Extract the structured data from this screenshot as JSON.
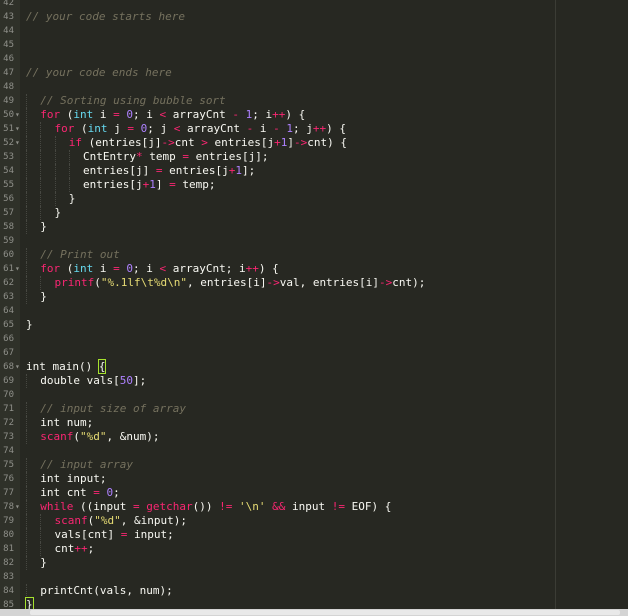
{
  "editor": {
    "colors": {
      "background": "#272822",
      "comment": "#75715e",
      "keyword": "#f92672",
      "type": "#66d9ef",
      "number": "#ae81ff",
      "string": "#e6db74",
      "function": "#a6e22e",
      "text": "#f8f8f2"
    },
    "lines": [
      {
        "n": "42",
        "fold": false,
        "indent": 0,
        "tokens": []
      },
      {
        "n": "43",
        "fold": false,
        "indent": 0,
        "tokens": [
          {
            "t": "// your code starts here",
            "c": "comment"
          }
        ]
      },
      {
        "n": "44",
        "fold": false,
        "indent": 0,
        "tokens": []
      },
      {
        "n": "45",
        "fold": false,
        "indent": 0,
        "tokens": []
      },
      {
        "n": "46",
        "fold": false,
        "indent": 0,
        "tokens": []
      },
      {
        "n": "47",
        "fold": false,
        "indent": 0,
        "tokens": [
          {
            "t": "// your code ends here",
            "c": "comment"
          }
        ]
      },
      {
        "n": "48",
        "fold": false,
        "indent": 0,
        "tokens": []
      },
      {
        "n": "49",
        "fold": false,
        "indent": 1,
        "tokens": [
          {
            "t": "// Sorting using bubble sort",
            "c": "comment"
          }
        ]
      },
      {
        "n": "50",
        "fold": true,
        "indent": 1,
        "tokens": [
          {
            "t": "for",
            "c": "keyword"
          },
          {
            "t": " (",
            "c": "text"
          },
          {
            "t": "int",
            "c": "type"
          },
          {
            "t": " i ",
            "c": "text"
          },
          {
            "t": "=",
            "c": "keyword"
          },
          {
            "t": " ",
            "c": "text"
          },
          {
            "t": "0",
            "c": "number"
          },
          {
            "t": "; i ",
            "c": "text"
          },
          {
            "t": "<",
            "c": "keyword"
          },
          {
            "t": " arrayCnt ",
            "c": "text"
          },
          {
            "t": "-",
            "c": "keyword"
          },
          {
            "t": " ",
            "c": "text"
          },
          {
            "t": "1",
            "c": "number"
          },
          {
            "t": "; i",
            "c": "text"
          },
          {
            "t": "++",
            "c": "keyword"
          },
          {
            "t": ") {",
            "c": "text"
          }
        ]
      },
      {
        "n": "51",
        "fold": true,
        "indent": 2,
        "tokens": [
          {
            "t": "for",
            "c": "keyword"
          },
          {
            "t": " (",
            "c": "text"
          },
          {
            "t": "int",
            "c": "type"
          },
          {
            "t": " j ",
            "c": "text"
          },
          {
            "t": "=",
            "c": "keyword"
          },
          {
            "t": " ",
            "c": "text"
          },
          {
            "t": "0",
            "c": "number"
          },
          {
            "t": "; j ",
            "c": "text"
          },
          {
            "t": "<",
            "c": "keyword"
          },
          {
            "t": " arrayCnt ",
            "c": "text"
          },
          {
            "t": "-",
            "c": "keyword"
          },
          {
            "t": " i ",
            "c": "text"
          },
          {
            "t": "-",
            "c": "keyword"
          },
          {
            "t": " ",
            "c": "text"
          },
          {
            "t": "1",
            "c": "number"
          },
          {
            "t": "; j",
            "c": "text"
          },
          {
            "t": "++",
            "c": "keyword"
          },
          {
            "t": ") {",
            "c": "text"
          }
        ]
      },
      {
        "n": "52",
        "fold": true,
        "indent": 3,
        "tokens": [
          {
            "t": "if",
            "c": "keyword"
          },
          {
            "t": " (entries[j]",
            "c": "text"
          },
          {
            "t": "->",
            "c": "keyword"
          },
          {
            "t": "cnt ",
            "c": "text"
          },
          {
            "t": ">",
            "c": "keyword"
          },
          {
            "t": " entries[j",
            "c": "text"
          },
          {
            "t": "+",
            "c": "keyword"
          },
          {
            "t": "1",
            "c": "number"
          },
          {
            "t": "]",
            "c": "text"
          },
          {
            "t": "->",
            "c": "keyword"
          },
          {
            "t": "cnt) {",
            "c": "text"
          }
        ]
      },
      {
        "n": "53",
        "fold": false,
        "indent": 4,
        "tokens": [
          {
            "t": "CntEntry",
            "c": "text"
          },
          {
            "t": "*",
            "c": "keyword"
          },
          {
            "t": " temp ",
            "c": "text"
          },
          {
            "t": "=",
            "c": "keyword"
          },
          {
            "t": " entries[j];",
            "c": "text"
          }
        ]
      },
      {
        "n": "54",
        "fold": false,
        "indent": 4,
        "tokens": [
          {
            "t": "entries[j] ",
            "c": "text"
          },
          {
            "t": "=",
            "c": "keyword"
          },
          {
            "t": " entries[j",
            "c": "text"
          },
          {
            "t": "+",
            "c": "keyword"
          },
          {
            "t": "1",
            "c": "number"
          },
          {
            "t": "];",
            "c": "text"
          }
        ]
      },
      {
        "n": "55",
        "fold": false,
        "indent": 4,
        "tokens": [
          {
            "t": "entries[j",
            "c": "text"
          },
          {
            "t": "+",
            "c": "keyword"
          },
          {
            "t": "1",
            "c": "number"
          },
          {
            "t": "] ",
            "c": "text"
          },
          {
            "t": "=",
            "c": "keyword"
          },
          {
            "t": " temp;",
            "c": "text"
          }
        ]
      },
      {
        "n": "56",
        "fold": false,
        "indent": 3,
        "tokens": [
          {
            "t": "}",
            "c": "text"
          }
        ]
      },
      {
        "n": "57",
        "fold": false,
        "indent": 2,
        "tokens": [
          {
            "t": "}",
            "c": "text"
          }
        ]
      },
      {
        "n": "58",
        "fold": false,
        "indent": 1,
        "tokens": [
          {
            "t": "}",
            "c": "text"
          }
        ]
      },
      {
        "n": "59",
        "fold": false,
        "indent": 0,
        "tokens": []
      },
      {
        "n": "60",
        "fold": false,
        "indent": 1,
        "tokens": [
          {
            "t": "// Print out",
            "c": "comment"
          }
        ]
      },
      {
        "n": "61",
        "fold": true,
        "indent": 1,
        "tokens": [
          {
            "t": "for",
            "c": "keyword"
          },
          {
            "t": " (",
            "c": "text"
          },
          {
            "t": "int",
            "c": "type"
          },
          {
            "t": " i ",
            "c": "text"
          },
          {
            "t": "=",
            "c": "keyword"
          },
          {
            "t": " ",
            "c": "text"
          },
          {
            "t": "0",
            "c": "number"
          },
          {
            "t": "; i ",
            "c": "text"
          },
          {
            "t": "<",
            "c": "keyword"
          },
          {
            "t": " arrayCnt; i",
            "c": "text"
          },
          {
            "t": "++",
            "c": "keyword"
          },
          {
            "t": ") {",
            "c": "text"
          }
        ]
      },
      {
        "n": "62",
        "fold": false,
        "indent": 2,
        "tokens": [
          {
            "t": "printf",
            "c": "keyword"
          },
          {
            "t": "(",
            "c": "text"
          },
          {
            "t": "\"%.1lf\\t%d\\n\"",
            "c": "string"
          },
          {
            "t": ", entries[i]",
            "c": "text"
          },
          {
            "t": "->",
            "c": "keyword"
          },
          {
            "t": "val, entries[i]",
            "c": "text"
          },
          {
            "t": "->",
            "c": "keyword"
          },
          {
            "t": "cnt);",
            "c": "text"
          }
        ]
      },
      {
        "n": "63",
        "fold": false,
        "indent": 1,
        "tokens": [
          {
            "t": "}",
            "c": "text"
          }
        ]
      },
      {
        "n": "64",
        "fold": false,
        "indent": 0,
        "tokens": []
      },
      {
        "n": "65",
        "fold": false,
        "indent": 0,
        "tokens": [
          {
            "t": "}",
            "c": "text"
          }
        ]
      },
      {
        "n": "66",
        "fold": false,
        "indent": 0,
        "tokens": []
      },
      {
        "n": "67",
        "fold": false,
        "indent": 0,
        "tokens": []
      },
      {
        "n": "68",
        "fold": true,
        "indent": 0,
        "tokens": [
          {
            "t": "int",
            "c": "text"
          },
          {
            "t": " main() ",
            "c": "text"
          },
          {
            "t": "{",
            "c": "brace"
          }
        ]
      },
      {
        "n": "69",
        "fold": false,
        "indent": 1,
        "tokens": [
          {
            "t": "double",
            "c": "text"
          },
          {
            "t": " vals[",
            "c": "text"
          },
          {
            "t": "50",
            "c": "number"
          },
          {
            "t": "];",
            "c": "text"
          }
        ]
      },
      {
        "n": "70",
        "fold": false,
        "indent": 0,
        "tokens": []
      },
      {
        "n": "71",
        "fold": false,
        "indent": 1,
        "tokens": [
          {
            "t": "// input size of array",
            "c": "comment"
          }
        ]
      },
      {
        "n": "72",
        "fold": false,
        "indent": 1,
        "tokens": [
          {
            "t": "int",
            "c": "text"
          },
          {
            "t": " num;",
            "c": "text"
          }
        ]
      },
      {
        "n": "73",
        "fold": false,
        "indent": 1,
        "tokens": [
          {
            "t": "scanf",
            "c": "keyword"
          },
          {
            "t": "(",
            "c": "text"
          },
          {
            "t": "\"%d\"",
            "c": "string"
          },
          {
            "t": ", &num);",
            "c": "text"
          }
        ]
      },
      {
        "n": "74",
        "fold": false,
        "indent": 0,
        "tokens": []
      },
      {
        "n": "75",
        "fold": false,
        "indent": 1,
        "tokens": [
          {
            "t": "// input array",
            "c": "comment"
          }
        ]
      },
      {
        "n": "76",
        "fold": false,
        "indent": 1,
        "tokens": [
          {
            "t": "int",
            "c": "text"
          },
          {
            "t": " input;",
            "c": "text"
          }
        ]
      },
      {
        "n": "77",
        "fold": false,
        "indent": 1,
        "tokens": [
          {
            "t": "int",
            "c": "text"
          },
          {
            "t": " cnt ",
            "c": "text"
          },
          {
            "t": "=",
            "c": "keyword"
          },
          {
            "t": " ",
            "c": "text"
          },
          {
            "t": "0",
            "c": "number"
          },
          {
            "t": ";",
            "c": "text"
          }
        ]
      },
      {
        "n": "78",
        "fold": true,
        "indent": 1,
        "tokens": [
          {
            "t": "while",
            "c": "keyword"
          },
          {
            "t": " ((input ",
            "c": "text"
          },
          {
            "t": "=",
            "c": "keyword"
          },
          {
            "t": " ",
            "c": "text"
          },
          {
            "t": "getchar",
            "c": "keyword"
          },
          {
            "t": "()) ",
            "c": "text"
          },
          {
            "t": "!=",
            "c": "keyword"
          },
          {
            "t": " ",
            "c": "text"
          },
          {
            "t": "'\\n'",
            "c": "string"
          },
          {
            "t": " ",
            "c": "text"
          },
          {
            "t": "&&",
            "c": "keyword"
          },
          {
            "t": " input ",
            "c": "text"
          },
          {
            "t": "!=",
            "c": "keyword"
          },
          {
            "t": " EOF) {",
            "c": "text"
          }
        ]
      },
      {
        "n": "79",
        "fold": false,
        "indent": 2,
        "tokens": [
          {
            "t": "scanf",
            "c": "keyword"
          },
          {
            "t": "(",
            "c": "text"
          },
          {
            "t": "\"%d\"",
            "c": "string"
          },
          {
            "t": ", &input);",
            "c": "text"
          }
        ]
      },
      {
        "n": "80",
        "fold": false,
        "indent": 2,
        "tokens": [
          {
            "t": "vals[cnt] ",
            "c": "text"
          },
          {
            "t": "=",
            "c": "keyword"
          },
          {
            "t": " input;",
            "c": "text"
          }
        ]
      },
      {
        "n": "81",
        "fold": false,
        "indent": 2,
        "tokens": [
          {
            "t": "cnt",
            "c": "text"
          },
          {
            "t": "++",
            "c": "keyword"
          },
          {
            "t": ";",
            "c": "text"
          }
        ]
      },
      {
        "n": "82",
        "fold": false,
        "indent": 1,
        "tokens": [
          {
            "t": "}",
            "c": "text"
          }
        ]
      },
      {
        "n": "83",
        "fold": false,
        "indent": 0,
        "tokens": []
      },
      {
        "n": "84",
        "fold": false,
        "indent": 1,
        "tokens": [
          {
            "t": "printCnt(vals, num);",
            "c": "text"
          }
        ]
      },
      {
        "n": "85",
        "fold": false,
        "indent": 0,
        "tokens": [
          {
            "t": "}",
            "c": "brace"
          }
        ]
      }
    ]
  }
}
